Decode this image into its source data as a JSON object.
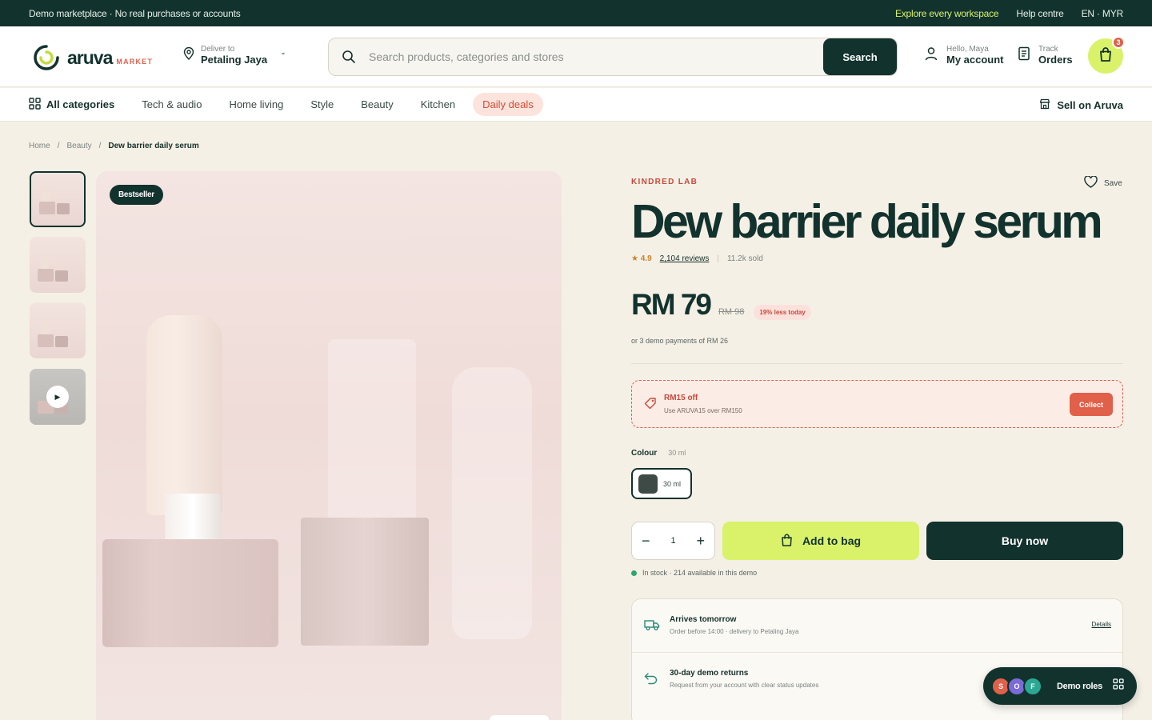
{
  "topbar": {
    "notice": "Demo marketplace · No real purchases or accounts",
    "explore": "Explore every workspace",
    "help": "Help centre",
    "locale": "EN · MYR"
  },
  "header": {
    "logo_word": "aruva",
    "logo_sub": "MARKET",
    "deliver_label": "Deliver to",
    "deliver_location": "Petaling Jaya",
    "search_placeholder": "Search products, categories and stores",
    "search_button": "Search",
    "account_greeting": "Hello, Maya",
    "account_label": "My account",
    "orders_small": "Track",
    "orders_label": "Orders",
    "bag_count": "3"
  },
  "nav": {
    "all_categories": "All categories",
    "items": [
      "Tech & audio",
      "Home living",
      "Style",
      "Beauty",
      "Kitchen"
    ],
    "deals": "Daily deals",
    "sell": "Sell on Aruva"
  },
  "breadcrumb": {
    "home": "Home",
    "sep": "/",
    "category": "Beauty",
    "current": "Dew barrier daily serum"
  },
  "gallery": {
    "badge": "Bestseller",
    "play_icon": "play-icon"
  },
  "product": {
    "brand": "KINDRED LAB",
    "save_label": "Save",
    "title": "Dew barrier daily serum",
    "rating": "★ 4.9",
    "reviews": "2,104 reviews",
    "sep": "|",
    "sold": "11.2k sold",
    "price": "RM 79",
    "was_price": "RM 98",
    "discount": "19% less today",
    "installments": "or 3 demo payments of RM 26"
  },
  "coupon": {
    "title": "RM15 off",
    "detail": "Use ARUVA15 over RM150",
    "button": "Collect"
  },
  "variant": {
    "label": "Colour",
    "selected": "30 ml",
    "option_label": "30 ml",
    "option_color": "#3d4a45"
  },
  "purchase": {
    "quantity": "1",
    "minus": "−",
    "plus": "+",
    "add_to_bag": "Add to bag",
    "buy_now": "Buy now",
    "stock": "In stock · 214 available in this demo"
  },
  "delivery": {
    "rows": [
      {
        "title": "Arrives tomorrow",
        "subtitle": "Order before 14:00 · delivery to Petaling Jaya",
        "link": "Details"
      },
      {
        "title": "30-day demo returns",
        "subtitle": "Request from your account with clear status updates"
      }
    ]
  },
  "roles": {
    "label": "Demo roles",
    "avatars": [
      "S",
      "O",
      "F"
    ],
    "avatar_colors": [
      "#e0604a",
      "#7b6bd6",
      "#2aa894"
    ]
  },
  "colors": {
    "brand_dark": "#12322d",
    "accent_lime": "#d9f26a",
    "accent_coral": "#e0604a",
    "background": "#f5f0e6"
  }
}
